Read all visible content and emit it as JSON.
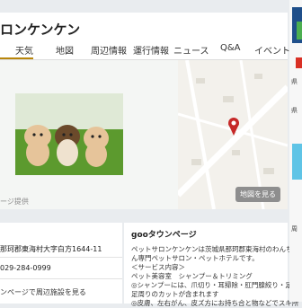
{
  "header": {
    "shop_name": "ロンケンケン"
  },
  "nav": {
    "tabs": [
      "天気",
      "地図",
      "周辺情報",
      "運行情報",
      "ニュース",
      "Q&A",
      "イベント"
    ]
  },
  "photo": {
    "credit": "ージ提供",
    "colors": {
      "grass": "#5c9a2e",
      "puppy_light": "#e6c49a",
      "puppy_dark": "#6b4a2b"
    }
  },
  "map": {
    "button_label": "地図を見る",
    "pin_color": "#c62828"
  },
  "info": {
    "address": "那珂郡東海村大字白方1644-11",
    "phone": "029-284-0999",
    "nearby_link": "ンページで周辺施設を見る"
  },
  "description": {
    "title": "gooタウンページ",
    "lines": [
      "ペットサロンケンケンは茨城県那珂郡東海村のわんちゃ",
      "ん専門ペットサロン・ペットホテルです。",
      "＜サービス内容＞",
      "ペット美容室　シャンプー＆トリミング",
      "◎シャンプーには、爪切り・耳掃除・肛門腺絞り・足裏",
      "足周りのカットが含まれます",
      "◎皮膚、左右がん、皮ズ方にお持ち合と物などでスキ所"
    ]
  },
  "sidebar": {
    "labels": [
      "県",
      "県",
      "周"
    ]
  }
}
